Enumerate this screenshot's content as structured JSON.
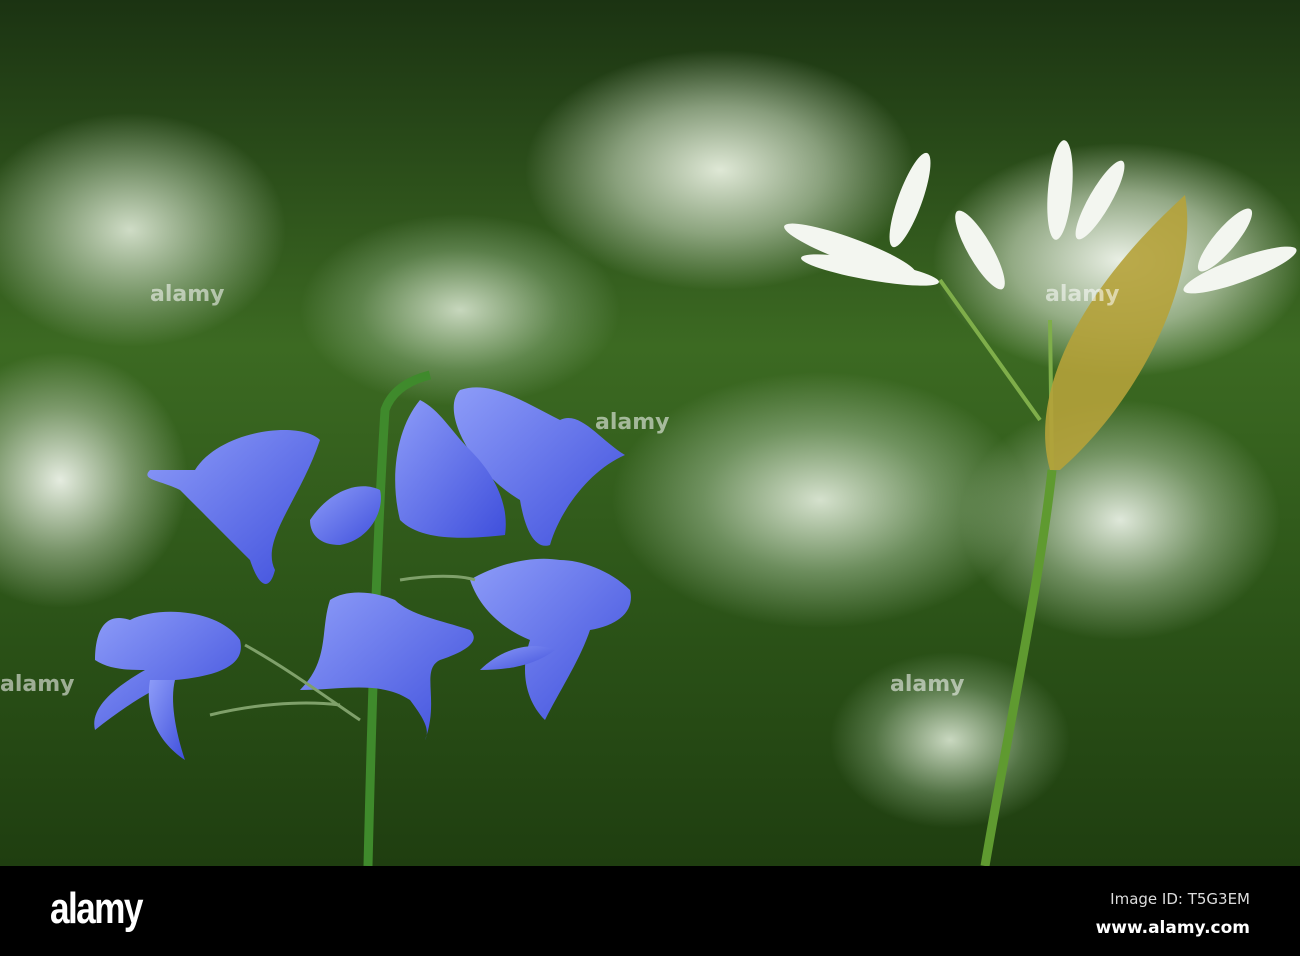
{
  "watermark_text": "alamy",
  "footer": {
    "logo": "alamy",
    "image_id": "Image ID: T5G3EM",
    "url": "www.alamy.com"
  },
  "colors": {
    "bluebell": "#5a6ef0",
    "foliage": "#3c6a22",
    "flower_white": "#eef2ea"
  }
}
